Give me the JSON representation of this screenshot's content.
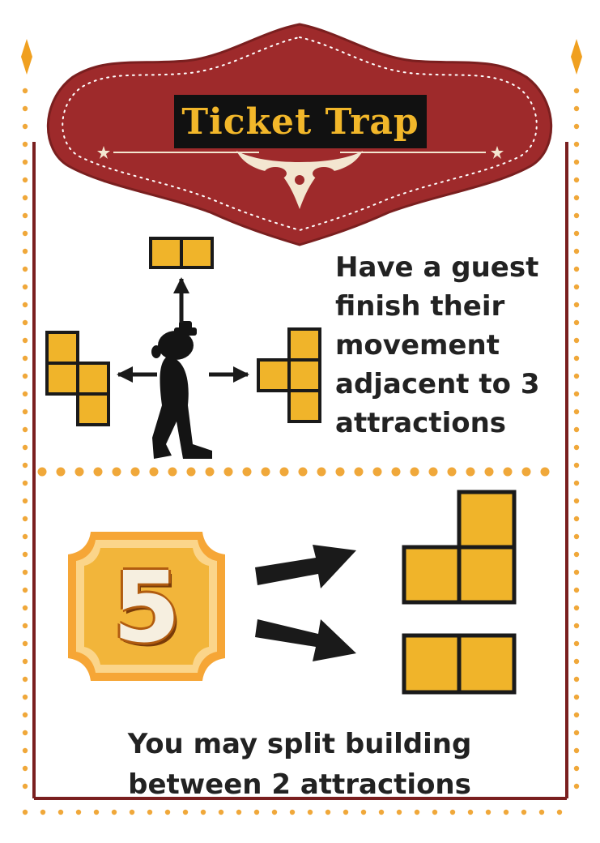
{
  "card": {
    "title": "Ticket Trap",
    "goal_lines": [
      "Have a guest",
      "finish their",
      "movement",
      "adjacent to 3",
      "attractions"
    ],
    "reward_value": "5",
    "reward_lines": [
      "You may split building",
      "between 2 attractions"
    ]
  },
  "icons": {
    "banner": "scalloped-red-banner",
    "guest": "guest-silhouette-icon",
    "coin": "gold-coin-icon",
    "tile": "attraction-tile-icon",
    "arrow": "arrow-icon"
  },
  "colors": {
    "banner_red": "#9e2a2b",
    "gold": "#f0b42a",
    "orange_dots": "#f0a83a",
    "outline": "#1a1a1a",
    "frame": "#7a1f1f"
  }
}
